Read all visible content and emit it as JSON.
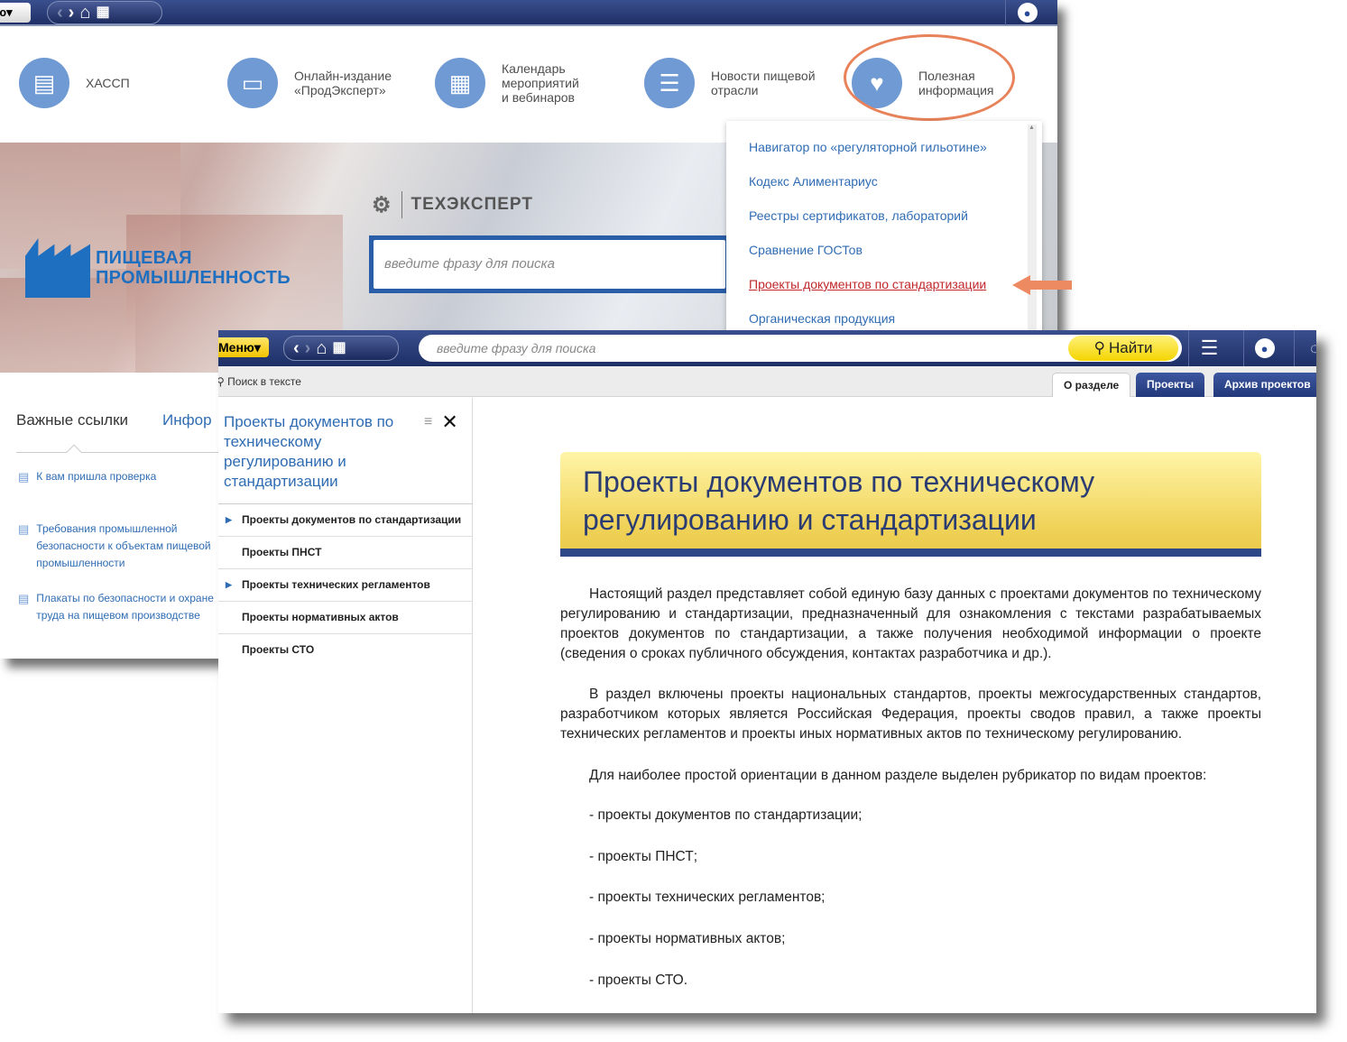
{
  "back_window": {
    "topbar": {
      "menu_label": "ю",
      "menu_caret": "▾",
      "nav_icons": [
        "chevron-left-icon",
        "chevron-right-icon",
        "home-icon",
        "grid-icon"
      ],
      "avatar_icon": "user-icon"
    },
    "nav_items": [
      {
        "label": "ХАССП",
        "icon": "folders-icon"
      },
      {
        "label": "Онлайн-издание\n«ПродЭксперт»",
        "icon": "monitor-icon"
      },
      {
        "label": "Календарь\nмероприятий\nи вебинаров",
        "icon": "calendar-icon"
      },
      {
        "label": "Новости пищевой\nотрасли",
        "icon": "newspaper-icon"
      },
      {
        "label": "Полезная\nинформация",
        "icon": "info-doc-icon"
      }
    ],
    "logo_text": "ПИЩЕВАЯ\nПРОМЫШЛЕННОСТЬ",
    "brand": "ТЕХЭКСПЕРТ",
    "search_placeholder": "введите фразу для поиска",
    "dropdown_items": [
      "Навигатор по «регуляторной гильотине»",
      "Кодекс Алиментариус",
      "Реестры сертификатов, лабораторий",
      "Сравнение ГОСТов",
      "Проекты документов по стандартизации",
      "Органическая продукция"
    ],
    "dropdown_active_index": 4,
    "links_tabs": [
      "Важные ссылки",
      "Инфор"
    ],
    "links": [
      "К вам пришла проверка",
      "Требования промышленной\nбезопасности к объектам пищевой\nпромышленности",
      "Плакаты по безопасности и охране\nтруда на пищевом производстве"
    ]
  },
  "front_window": {
    "menu_label": "Меню",
    "menu_caret": "▾",
    "search_placeholder": "введите фразу для поиска",
    "find_label": "Найти",
    "search_in_text": "Поиск в тексте",
    "tabs": [
      "О разделе",
      "Проекты",
      "Архив проектов"
    ],
    "active_tab": 0,
    "sidebar_title": "Проекты документов по техническому регулированию и стандартизации",
    "sidebar_items": [
      {
        "label": "Проекты документов по стандартизации",
        "expandable": true
      },
      {
        "label": "Проекты ПНСТ",
        "expandable": false
      },
      {
        "label": "Проекты технических регламентов",
        "expandable": true
      },
      {
        "label": "Проекты нормативных актов",
        "expandable": false
      },
      {
        "label": "Проекты СТО",
        "expandable": false
      }
    ],
    "content_title": "Проекты документов по техническому регулированию и стандартизации",
    "paragraphs": [
      "Настоящий раздел представляет собой единую базу данных с проектами документов по техническому регулированию и стандартизации, предназначенный для ознакомления с текстами разрабатываемых проектов документов по стандартизации, а также получения необходимой информации о проекте (сведения о сроках публичного обсуждения,  контактах разработчика и др.).",
      "В раздел включены проекты национальных стандартов, проекты межгосударственных стандартов, разработчиком которых является Российская Федерация, проекты сводов правил, а также проекты технических регламентов и проекты иных нормативных актов по техническому регулированию.",
      "Для наиболее простой ориентации в данном разделе выделен рубрикатор по видам проектов:"
    ],
    "list_items": [
      "- проекты документов по стандартизации;",
      "- проекты ПНСТ;",
      "- проекты технических регламентов;",
      "- проекты нормативных актов;",
      "- проекты СТО."
    ]
  },
  "colors": {
    "topbar": "#1e2f66",
    "accent_blue": "#2f6cb3",
    "icon_circle": "#6f9ad3",
    "highlight": "#e8825a",
    "find_yellow": "#f4d400",
    "title_navy": "#2b3c73"
  }
}
